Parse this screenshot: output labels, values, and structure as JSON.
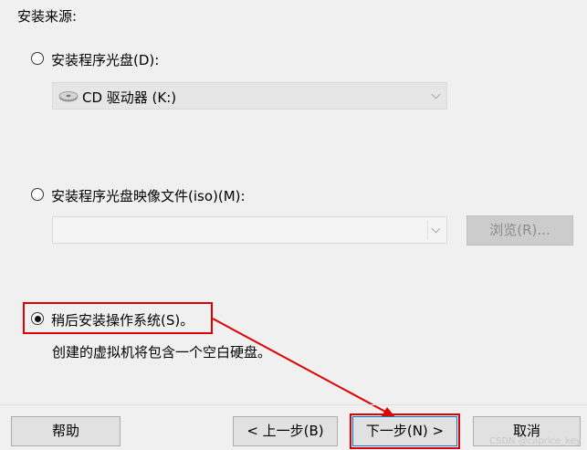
{
  "source": {
    "heading": "安装来源:",
    "disc_option": "安装程序光盘(D):",
    "disc_drive": "CD 驱动器 (K:)",
    "iso_option": "安装程序光盘映像文件(iso)(M):",
    "iso_path": "",
    "browse_label": "浏览(R)...",
    "later_option": "稍后安装操作系统(S)。",
    "later_desc": "创建的虚拟机将包含一个空白硬盘。",
    "selected": "later"
  },
  "footer": {
    "help_label": "帮助",
    "back_label": "< 上一步(B)",
    "next_label": "下一步(N) >",
    "cancel_label": "取消"
  },
  "watermark": "CSDN @caprice_key",
  "colors": {
    "highlight": "#e00000",
    "arrow": "#e00000",
    "primary_border": "#0078d7"
  }
}
